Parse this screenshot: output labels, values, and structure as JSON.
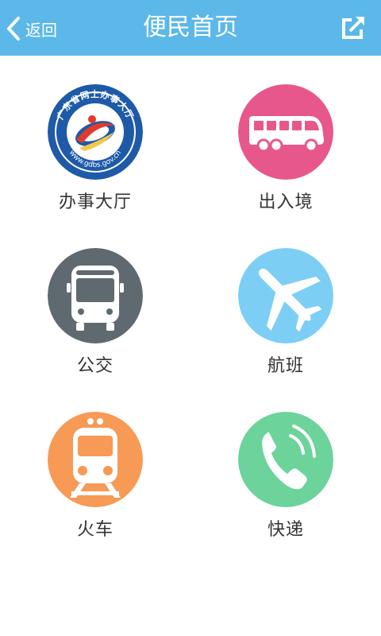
{
  "header": {
    "back_label": "返回",
    "title": "便民首页",
    "share_icon": "share-icon"
  },
  "colors": {
    "header_bg": "#5bb8e8",
    "office": "#1e5aa8",
    "exit_entry": "#e8578b",
    "bus": "#5f6a70",
    "flight": "#7ccef5",
    "train": "#f79a55",
    "express": "#6cd39a"
  },
  "tiles": [
    {
      "label": "办事大厅",
      "icon": "government-hall-logo",
      "logo_text_top": "广东省网上办事大厅",
      "logo_text_bottom": "www.gdbs.gov.cn"
    },
    {
      "label": "出入境",
      "icon": "coach-bus-icon"
    },
    {
      "label": "公交",
      "icon": "bus-icon"
    },
    {
      "label": "航班",
      "icon": "airplane-icon"
    },
    {
      "label": "火车",
      "icon": "train-icon"
    },
    {
      "label": "快递",
      "icon": "phone-icon"
    }
  ]
}
